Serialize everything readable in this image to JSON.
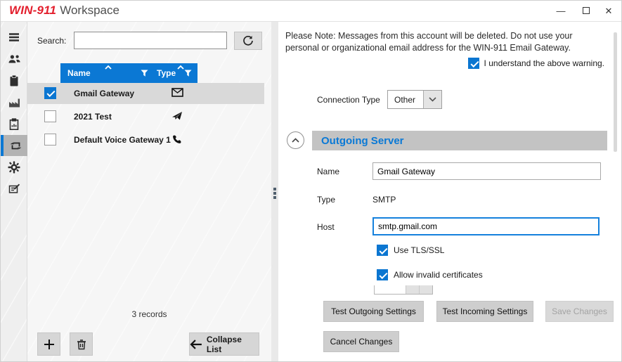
{
  "window": {
    "brand": "WIN-911",
    "product": "Workspace",
    "minimize_glyph": "—",
    "close_glyph": "✕"
  },
  "sidebar": {
    "items": [
      {
        "icon": "menu-icon",
        "selected": false
      },
      {
        "icon": "contacts-icon",
        "selected": false
      },
      {
        "icon": "clipboard-icon",
        "selected": false
      },
      {
        "icon": "factory-icon",
        "selected": false
      },
      {
        "icon": "report-icon",
        "selected": false
      },
      {
        "icon": "gateway-loop-icon",
        "selected": true
      },
      {
        "icon": "settings-gear-icon",
        "selected": false
      },
      {
        "icon": "notes-icon",
        "selected": false
      }
    ]
  },
  "list_panel": {
    "search_label": "Search:",
    "search_value": "",
    "columns": {
      "name": "Name",
      "type": "Type"
    },
    "rows": [
      {
        "name": "Gmail Gateway",
        "type_icon": "email-icon",
        "checked": true,
        "selected": true
      },
      {
        "name": "2021 Test",
        "type_icon": "send-icon",
        "checked": false,
        "selected": false
      },
      {
        "name": "Default Voice Gateway 1",
        "type_icon": "phone-icon",
        "checked": false,
        "selected": false
      }
    ],
    "records_text": "3 records",
    "collapse_button_label": "Collapse List"
  },
  "detail_panel": {
    "note": "Please Note: Messages from this account will be deleted. Do not use your personal or organizational email address for the WIN-911 Email Gateway.",
    "warning_checkbox": {
      "label": "I understand the above warning.",
      "checked": true
    },
    "connection_type": {
      "label": "Connection Type",
      "value": "Other"
    },
    "outgoing_server": {
      "title": "Outgoing Server",
      "name_label": "Name",
      "name_value": "Gmail Gateway",
      "type_label": "Type",
      "type_value": "SMTP",
      "host_label": "Host",
      "host_value": "smtp.gmail.com",
      "tls_checkbox": {
        "label": "Use TLS/SSL",
        "checked": true
      },
      "cert_checkbox": {
        "label": "Allow invalid certificates",
        "checked": true
      }
    },
    "buttons": {
      "test_outgoing": "Test Outgoing Settings",
      "test_incoming": "Test Incoming Settings",
      "save": "Save Changes",
      "save_enabled": false,
      "cancel": "Cancel Changes"
    }
  },
  "colors": {
    "accent_blue": "#0b78d4",
    "brand_red": "#e3202e",
    "selected_row": "#d9d9d9",
    "header_gray": "#c3c3c3"
  }
}
